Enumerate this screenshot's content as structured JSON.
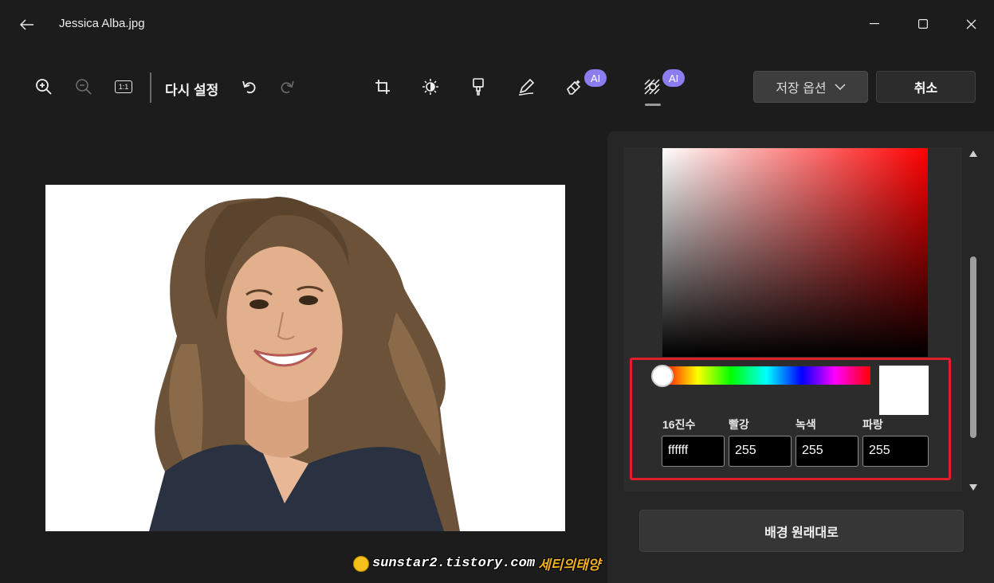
{
  "window": {
    "title": "Jessica Alba.jpg",
    "back_icon": "arrow-left-icon",
    "minimize_icon": "minimize-icon",
    "maximize_icon": "maximize-icon",
    "close_icon": "close-icon"
  },
  "toolbar": {
    "zoom_in_icon": "zoom-in-icon",
    "zoom_out_icon": "zoom-out-icon",
    "actual_size_label": "1:1",
    "reset_label": "다시 설정",
    "undo_icon": "undo-icon",
    "redo_icon": "redo-icon",
    "tools": [
      {
        "name": "crop",
        "icon": "crop-icon"
      },
      {
        "name": "adjust",
        "icon": "brightness-icon"
      },
      {
        "name": "filter",
        "icon": "brush-icon"
      },
      {
        "name": "markup",
        "icon": "pen-icon"
      },
      {
        "name": "erase",
        "icon": "eraser-icon",
        "badge": "AI"
      },
      {
        "name": "background",
        "icon": "background-icon",
        "badge": "AI",
        "active": true
      }
    ],
    "save_options_label": "저장 옵션",
    "cancel_label": "취소"
  },
  "photo": {
    "subject": "portrait-photo",
    "background_color": "#ffffff"
  },
  "watermark": {
    "url": "sunstar2.tistory.com",
    "name": "세티의태양"
  },
  "color_picker": {
    "hue_color": "#ff0000",
    "selected_color": "#ffffff",
    "fields": {
      "hex_label": "16진수",
      "hex_value": "ffffff",
      "red_label": "빨강",
      "red_value": "255",
      "green_label": "녹색",
      "green_value": "255",
      "blue_label": "파랑",
      "blue_value": "255"
    },
    "highlight_color": "#e01f2a"
  },
  "reset_background_label": "배경 원래대로"
}
